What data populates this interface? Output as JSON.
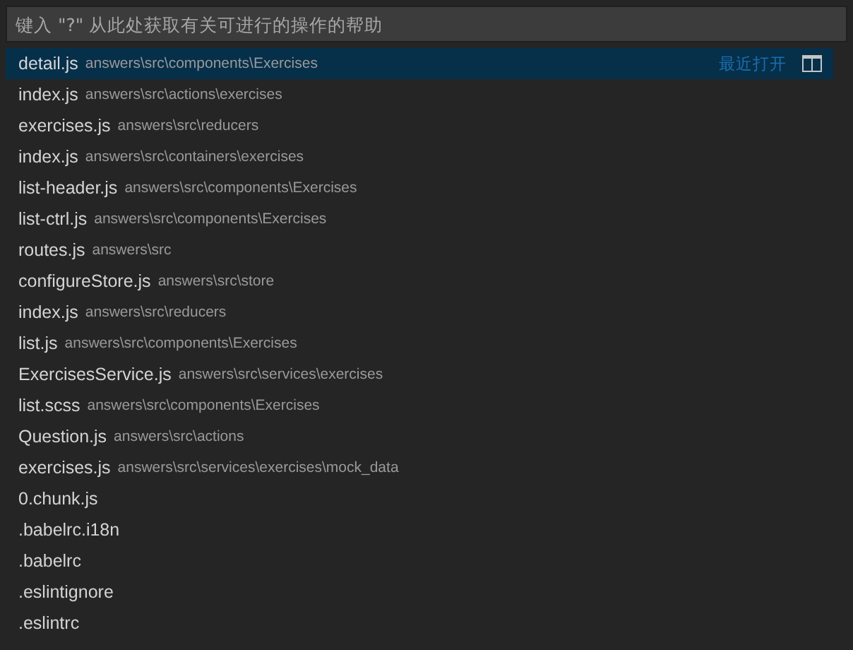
{
  "search": {
    "placeholder": "键入 \"?\" 从此处获取有关可进行的操作的帮助"
  },
  "results": [
    {
      "name": "detail.js",
      "path": "answers\\src\\components\\Exercises",
      "selected": true,
      "badge": "最近打开"
    },
    {
      "name": "index.js",
      "path": "answers\\src\\actions\\exercises",
      "selected": false
    },
    {
      "name": "exercises.js",
      "path": "answers\\src\\reducers",
      "selected": false
    },
    {
      "name": "index.js",
      "path": "answers\\src\\containers\\exercises",
      "selected": false
    },
    {
      "name": "list-header.js",
      "path": "answers\\src\\components\\Exercises",
      "selected": false
    },
    {
      "name": "list-ctrl.js",
      "path": "answers\\src\\components\\Exercises",
      "selected": false
    },
    {
      "name": "routes.js",
      "path": "answers\\src",
      "selected": false
    },
    {
      "name": "configureStore.js",
      "path": "answers\\src\\store",
      "selected": false
    },
    {
      "name": "index.js",
      "path": "answers\\src\\reducers",
      "selected": false
    },
    {
      "name": "list.js",
      "path": "answers\\src\\components\\Exercises",
      "selected": false
    },
    {
      "name": "ExercisesService.js",
      "path": "answers\\src\\services\\exercises",
      "selected": false
    },
    {
      "name": "list.scss",
      "path": "answers\\src\\components\\Exercises",
      "selected": false
    },
    {
      "name": "Question.js",
      "path": "answers\\src\\actions",
      "selected": false
    },
    {
      "name": "exercises.js",
      "path": "answers\\src\\services\\exercises\\mock_data",
      "selected": false
    },
    {
      "name": "0.chunk.js",
      "selected": false
    },
    {
      "name": ".babelrc.i18n",
      "selected": false
    },
    {
      "name": ".babelrc",
      "selected": false
    },
    {
      "name": ".eslintignore",
      "selected": false
    },
    {
      "name": ".eslintrc",
      "selected": false
    }
  ]
}
